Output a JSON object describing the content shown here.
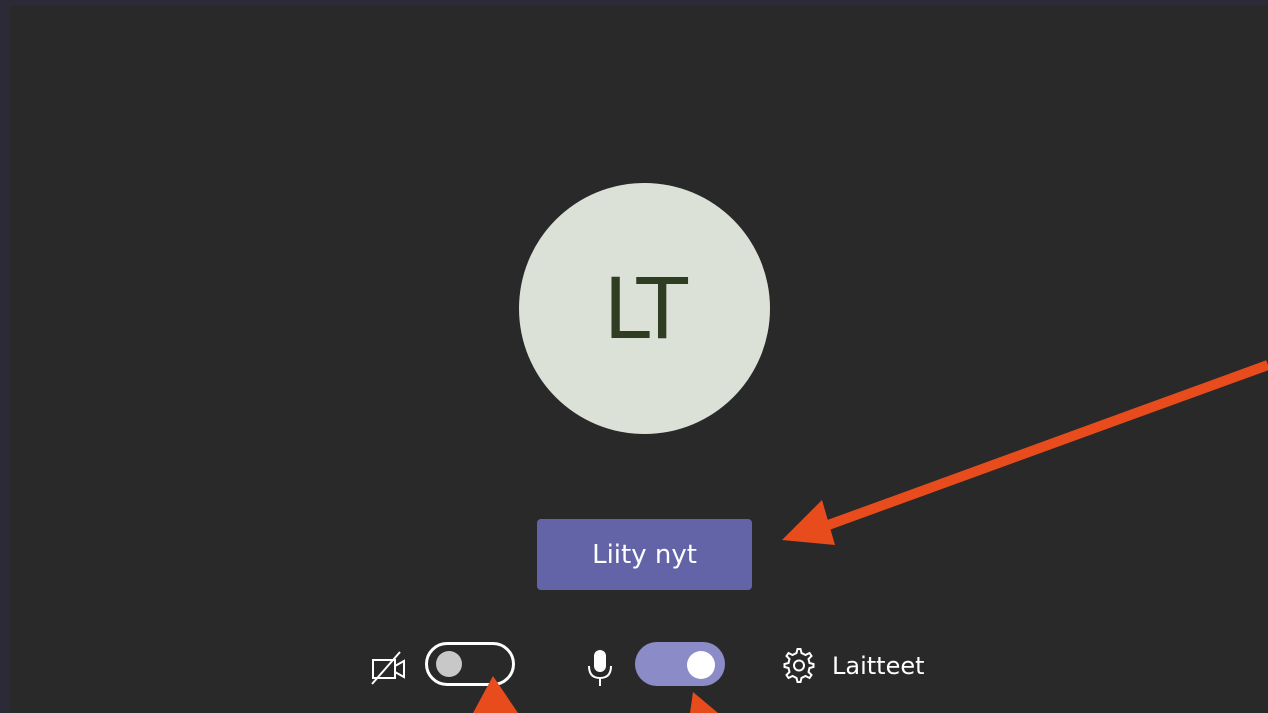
{
  "avatar": {
    "initials": "LT"
  },
  "join_button": {
    "label": "Liity nyt"
  },
  "controls": {
    "camera": {
      "icon": "camera-off-icon",
      "enabled": false
    },
    "microphone": {
      "icon": "microphone-icon",
      "enabled": true
    },
    "devices": {
      "icon": "gear-icon",
      "label": "Laitteet"
    }
  },
  "colors": {
    "background": "#292929",
    "avatar_bg": "#dbe1d7",
    "avatar_text": "#2f3d22",
    "join_button": "#6264a7",
    "toggle_on": "#8b8cc7",
    "annotation_arrow": "#e84c1c"
  }
}
